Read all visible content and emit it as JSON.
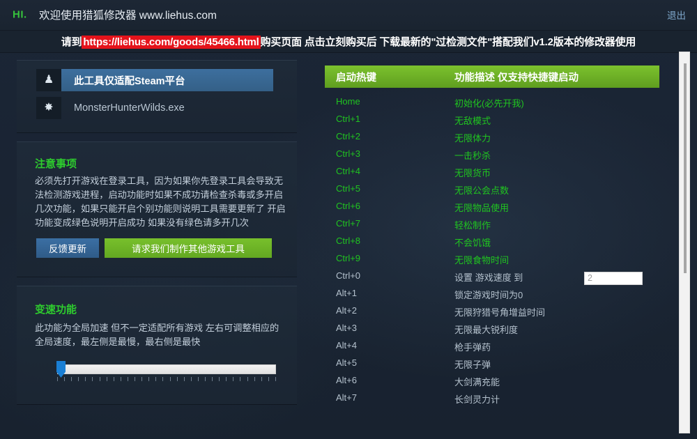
{
  "titlebar": {
    "hi": "HI.",
    "welcome": "欢迎使用猎狐修改器 www.liehus.com",
    "exit_label": "退出"
  },
  "banner": {
    "prefix": "请到",
    "url": "https://liehus.com/goods/45466.html",
    "suffix": "购买页面 点击立刻购买后 下载最新的\"过检测文件\"搭配我们v1.2版本的修改器使用",
    "url_bg_color": "#e4131b"
  },
  "target_card": {
    "rows": [
      {
        "icon": "user-icon",
        "glyph": "♟",
        "label": "此工具仅适配Steam平台",
        "selected": true
      },
      {
        "icon": "gear-icon",
        "glyph": "✸",
        "label": "MonsterHunterWilds.exe",
        "selected": false
      }
    ]
  },
  "notes_card": {
    "title": "注意事项",
    "body": "必须先打开游戏在登录工具，因为如果你先登录工具会导致无法检测游戏进程，启动功能时如果不成功请检查杀毒或多开启几次功能，如果只能开启个别功能则说明工具需要更新了 开启功能变成绿色说明开启成功 如果没有绿色请多开几次",
    "feedback_button": "反馈更新",
    "request_button": "请求我们制作其他游戏工具"
  },
  "speed_card": {
    "title": "变速功能",
    "body": "此功能为全局加速 但不一定适配所有游戏 左右可调整相应的全局速度，最左侧是最慢，最右侧是最快",
    "slider": {
      "value": 0,
      "min": 0,
      "max": 100,
      "ticks": 32
    }
  },
  "hotkey_panel": {
    "header": {
      "key_col": "启动热键",
      "desc_col": "功能描述 仅支持快捷键启动"
    },
    "active_color": "#20c420",
    "inactive_color": "#b4c1cd",
    "rows": [
      {
        "key": "Home",
        "desc": "初始化(必先开我)",
        "active": true
      },
      {
        "key": "Ctrl+1",
        "desc": "无敌模式",
        "active": true
      },
      {
        "key": "Ctrl+2",
        "desc": "无限体力",
        "active": true
      },
      {
        "key": "Ctrl+3",
        "desc": "一击秒杀",
        "active": true
      },
      {
        "key": "Ctrl+4",
        "desc": "无限货币",
        "active": true
      },
      {
        "key": "Ctrl+5",
        "desc": "无限公会点数",
        "active": true
      },
      {
        "key": "Ctrl+6",
        "desc": "无限物品使用",
        "active": true
      },
      {
        "key": "Ctrl+7",
        "desc": "轻松制作",
        "active": true
      },
      {
        "key": "Ctrl+8",
        "desc": "不会饥饿",
        "active": true
      },
      {
        "key": "Ctrl+9",
        "desc": "无限食物时间",
        "active": true
      },
      {
        "key": "Ctrl+0",
        "desc": "设置 游戏速度 到",
        "active": false
      },
      {
        "key": "Alt+1",
        "desc": "锁定游戏时间为0",
        "active": false
      },
      {
        "key": "Alt+2",
        "desc": "无限狩猎号角增益时间",
        "active": false
      },
      {
        "key": "Alt+3",
        "desc": "无限最大锐利度",
        "active": false
      },
      {
        "key": "Alt+4",
        "desc": "枪手弹药",
        "active": false
      },
      {
        "key": "Alt+5",
        "desc": "无限子弹",
        "active": false
      },
      {
        "key": "Alt+6",
        "desc": "大剑满充能",
        "active": false
      },
      {
        "key": "Alt+7",
        "desc": "长剑灵力计",
        "active": false
      }
    ],
    "speed_input": {
      "value": "2"
    }
  },
  "scrollbar": {
    "thumb_top_pct": 3,
    "thumb_height_pct": 55
  }
}
